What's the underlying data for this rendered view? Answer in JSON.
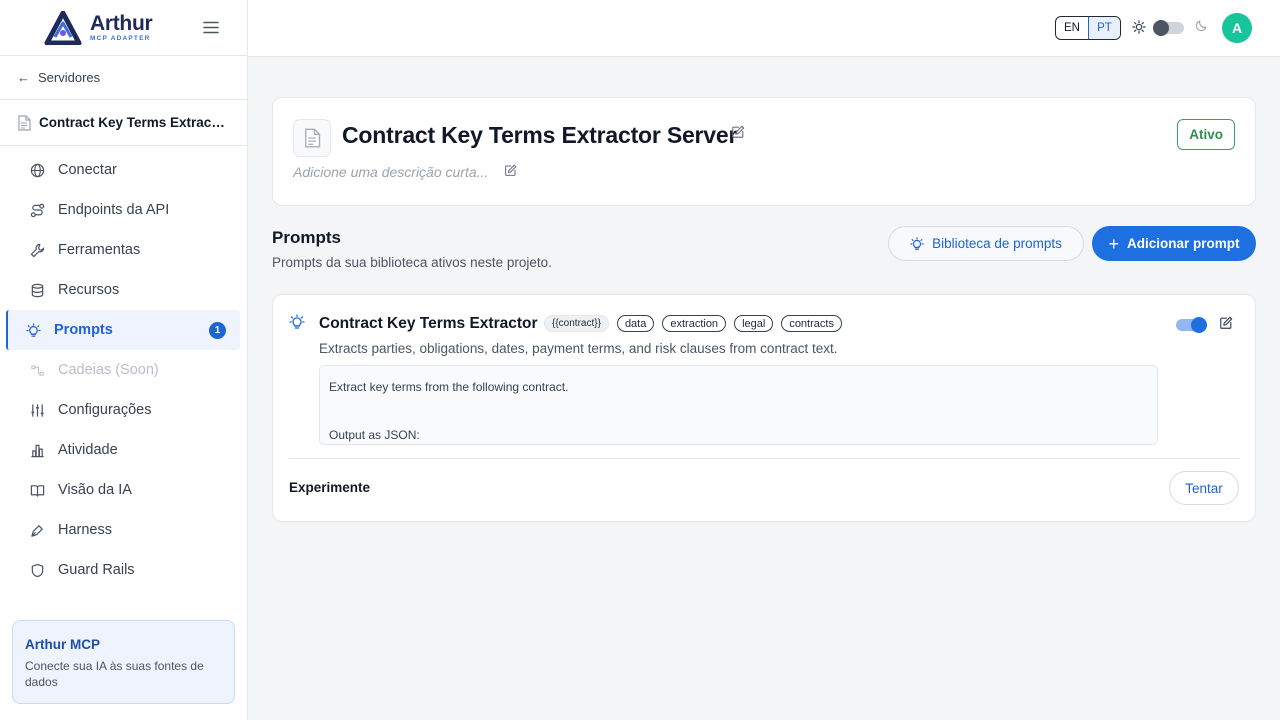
{
  "brand": {
    "name": "Arthur",
    "subtitle": "MCP ADAPTER"
  },
  "sidebar": {
    "back_label": "Servidores",
    "server_name": "Contract Key Terms Extracto...",
    "items": [
      {
        "label": "Conectar",
        "icon": "globe-icon"
      },
      {
        "label": "Endpoints da API",
        "icon": "route-icon"
      },
      {
        "label": "Ferramentas",
        "icon": "wrench-icon"
      },
      {
        "label": "Recursos",
        "icon": "database-icon"
      },
      {
        "label": "Prompts",
        "icon": "lightbulb-icon",
        "badge": "1"
      },
      {
        "label": "Cadeias (Soon)",
        "icon": "chain-icon"
      },
      {
        "label": "Configurações",
        "icon": "sliders-icon"
      },
      {
        "label": "Atividade",
        "icon": "bar-chart-icon"
      },
      {
        "label": "Visão da IA",
        "icon": "book-icon"
      },
      {
        "label": "Harness",
        "icon": "pen-tool-icon"
      },
      {
        "label": "Guard Rails",
        "icon": "shield-icon"
      }
    ],
    "promo": {
      "title": "Arthur MCP",
      "text": "Conecte sua IA às suas fontes de dados"
    }
  },
  "topbar": {
    "lang_en": "EN",
    "lang_pt": "PT",
    "avatar_initial": "A"
  },
  "header": {
    "title": "Contract Key Terms Extractor Server",
    "description_placeholder": "Adicione uma descrição curta...",
    "status": "Ativo"
  },
  "prompts_section": {
    "title": "Prompts",
    "subtitle": "Prompts da sua biblioteca ativos neste projeto.",
    "library_button": "Biblioteca de prompts",
    "add_button": "Adicionar prompt"
  },
  "prompt": {
    "title": "Contract Key Terms Extractor",
    "tags": [
      "{{contract}}",
      "data",
      "extraction",
      "legal",
      "contracts"
    ],
    "description": "Extracts parties, obligations, dates, payment terms, and risk clauses from contract text.",
    "template_line1": "Extract key terms from the following contract.",
    "template_line2": "Output as JSON:",
    "try_label": "Experimente",
    "try_button": "Tentar"
  }
}
